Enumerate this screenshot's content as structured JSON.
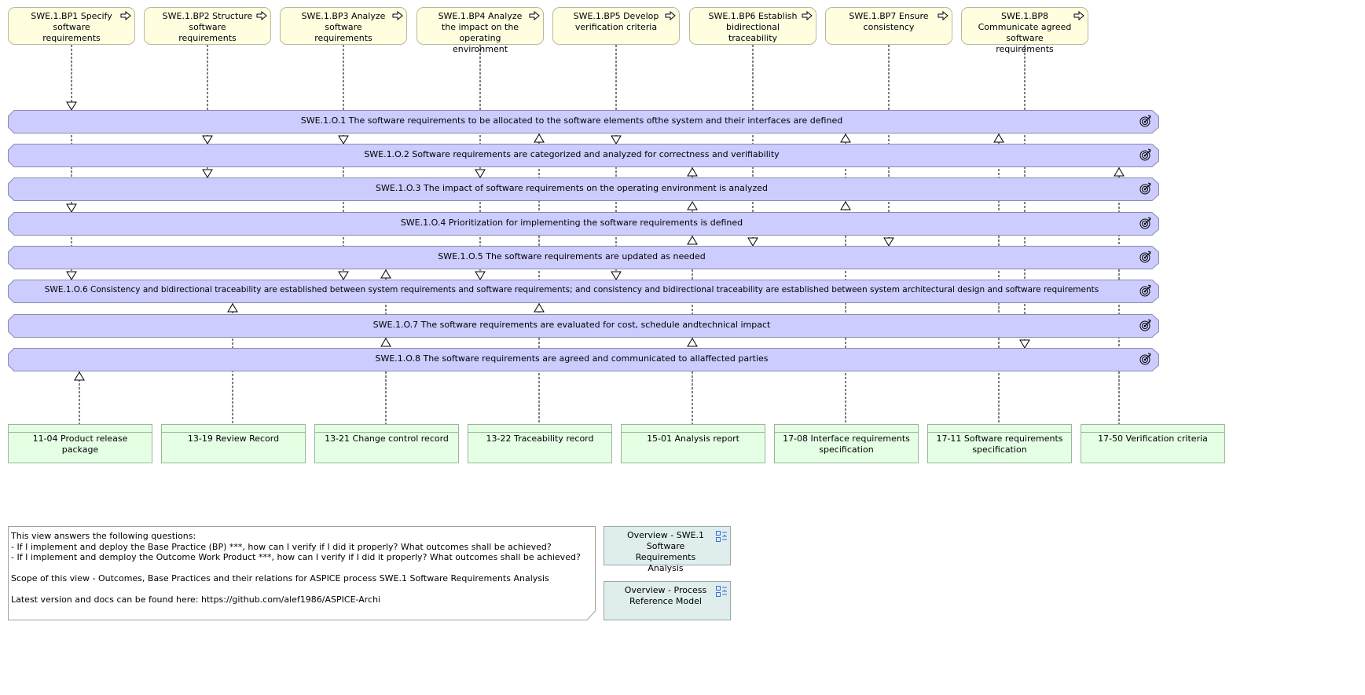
{
  "base_practices": [
    {
      "id": "SWE.1.BP1",
      "label": "SWE.1.BP1 Specify software requirements",
      "icon": "process-arrow-icon"
    },
    {
      "id": "SWE.1.BP2",
      "label": "SWE.1.BP2 Structure software requirements",
      "icon": "process-arrow-icon"
    },
    {
      "id": "SWE.1.BP3",
      "label": "SWE.1.BP3 Analyze software requirements",
      "icon": "process-arrow-icon"
    },
    {
      "id": "SWE.1.BP4",
      "label": "SWE.1.BP4 Analyze the impact on the operating environment",
      "icon": "process-arrow-icon"
    },
    {
      "id": "SWE.1.BP5",
      "label": "SWE.1.BP5 Develop verification criteria",
      "icon": "process-arrow-icon"
    },
    {
      "id": "SWE.1.BP6",
      "label": "SWE.1.BP6 Establish bidirectional traceability",
      "icon": "process-arrow-icon"
    },
    {
      "id": "SWE.1.BP7",
      "label": "SWE.1.BP7 Ensure consistency",
      "icon": "process-arrow-icon"
    },
    {
      "id": "SWE.1.BP8",
      "label": "SWE.1.BP8 Communicate agreed software requirements",
      "icon": "process-arrow-icon"
    }
  ],
  "outcomes": [
    {
      "id": "SWE.1.O.1",
      "label": "SWE.1.O.1 The software requirements to be allocated to the software elements ofthe system and their interfaces are defined",
      "icon": "goal-icon"
    },
    {
      "id": "SWE.1.O.2",
      "label": "SWE.1.O.2 Software requirements are categorized and analyzed for correctness and verifiability",
      "icon": "goal-icon"
    },
    {
      "id": "SWE.1.O.3",
      "label": "SWE.1.O.3 The impact of software requirements on the operating environment is analyzed",
      "icon": "goal-icon"
    },
    {
      "id": "SWE.1.O.4",
      "label": "SWE.1.O.4 Prioritization for implementing the software requirements is defined",
      "icon": "goal-icon"
    },
    {
      "id": "SWE.1.O.5",
      "label": "SWE.1.O.5 The software requirements are updated as needed",
      "icon": "goal-icon"
    },
    {
      "id": "SWE.1.O.6",
      "label": "SWE.1.O.6 Consistency and bidirectional traceability are established between system requirements and software requirements; and consistency and bidirectional traceability are established between system architectural design and software requirements",
      "icon": "goal-icon"
    },
    {
      "id": "SWE.1.O.7",
      "label": "SWE.1.O.7 The software requirements are evaluated for cost, schedule andtechnical impact",
      "icon": "goal-icon"
    },
    {
      "id": "SWE.1.O.8",
      "label": "SWE.1.O.8 The software requirements are agreed and communicated to allaffected parties",
      "icon": "goal-icon"
    }
  ],
  "work_products": [
    {
      "id": "11-04",
      "label": "11-04 Product release package"
    },
    {
      "id": "13-19",
      "label": "13-19 Review Record"
    },
    {
      "id": "13-21",
      "label": "13-21 Change control record"
    },
    {
      "id": "13-22",
      "label": "13-22 Traceability record"
    },
    {
      "id": "15-01",
      "label": "15-01 Analysis report"
    },
    {
      "id": "17-08",
      "label": "17-08 Interface requirements specification"
    },
    {
      "id": "17-11",
      "label": "17-11 Software requirements specification"
    },
    {
      "id": "17-50",
      "label": "17-50 Verification criteria"
    }
  ],
  "bp_to_outcome": [
    {
      "bp": 0,
      "outcomes": [
        0,
        3,
        5
      ]
    },
    {
      "bp": 1,
      "outcomes": [
        1,
        2
      ]
    },
    {
      "bp": 2,
      "outcomes": [
        1,
        5
      ]
    },
    {
      "bp": 3,
      "outcomes": [
        2,
        5
      ]
    },
    {
      "bp": 4,
      "outcomes": [
        1,
        5
      ]
    },
    {
      "bp": 5,
      "outcomes": [
        4
      ]
    },
    {
      "bp": 6,
      "outcomes": [
        4
      ]
    },
    {
      "bp": 7,
      "outcomes": [
        7
      ]
    }
  ],
  "wp_to_outcome": [
    {
      "wp": 0,
      "outcomes": [
        7
      ]
    },
    {
      "wp": 1,
      "outcomes": [
        5
      ]
    },
    {
      "wp": 2,
      "outcomes": [
        4,
        6
      ]
    },
    {
      "wp": 3,
      "outcomes": [
        0,
        5
      ]
    },
    {
      "wp": 4,
      "outcomes": [
        1,
        2,
        3,
        6
      ]
    },
    {
      "wp": 5,
      "outcomes": [
        0,
        2
      ]
    },
    {
      "wp": 6,
      "outcomes": [
        0
      ]
    },
    {
      "wp": 7,
      "outcomes": [
        1
      ]
    }
  ],
  "colors": {
    "bp_fill": "#ffffe0",
    "outcome_fill": "#ccccff",
    "outcome_border": "#8a8ab0",
    "wp_fill": "#e5ffe5",
    "overview_fill": "#dfeded"
  },
  "note": {
    "text": "This view answers the following questions:\n- If I implement and deploy the Base Practice (BP) ***, how can I verify if I did it properly? What outcomes shall be achieved?\n- If I implement and demploy the Outcome Work Product ***, how can I verify if I did it properly? What outcomes shall be achieved?\n\nScope of this view - Outcomes, Base Practices and their relations for ASPICE process SWE.1 Software Requirements Analysis\n\nLatest version and docs can be found here: https://github.com/alef1986/ASPICE-Archi"
  },
  "overview_links": [
    {
      "label": "Overview - SWE.1 Software Requirements Analysis",
      "icon": "view-reference-icon"
    },
    {
      "label": "Overview - Process Reference Model",
      "icon": "view-reference-icon"
    }
  ]
}
